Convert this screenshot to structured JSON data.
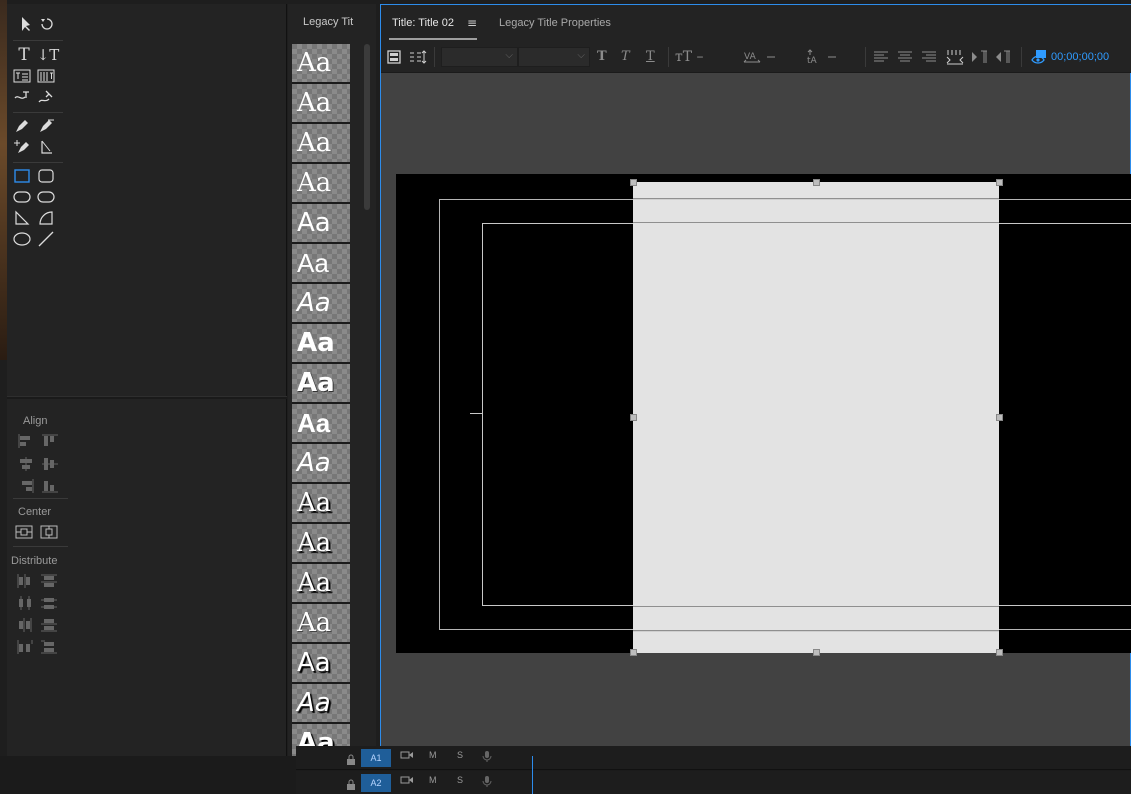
{
  "styles_panel": {
    "tab_label": "Legacy Tit",
    "swatches": [
      "Aa",
      "Aa",
      "Aa",
      "Aa",
      "Aa",
      "Aa",
      "Aa",
      "Aa",
      "Aa",
      "Aa",
      "Aa",
      "Aa",
      "Aa",
      "Aa",
      "Aa",
      "Aa",
      "Aa",
      "Aa"
    ]
  },
  "tools_panel": {
    "align_label": "Align",
    "center_label": "Center",
    "distribute_label": "Distribute"
  },
  "title_panel": {
    "active_tab": "Title: Title 02",
    "menu_icon": "≡",
    "second_tab": "Legacy Title Properties",
    "timecode": "00;00;00;00"
  },
  "tracks": [
    {
      "label": "A1",
      "m": "M",
      "s": "S"
    },
    {
      "label": "A2",
      "m": "M",
      "s": "S"
    }
  ],
  "colors": {
    "accent": "#2d8ceb",
    "timecode": "#2f9bff",
    "rect_fill": "#e3e3e3"
  }
}
